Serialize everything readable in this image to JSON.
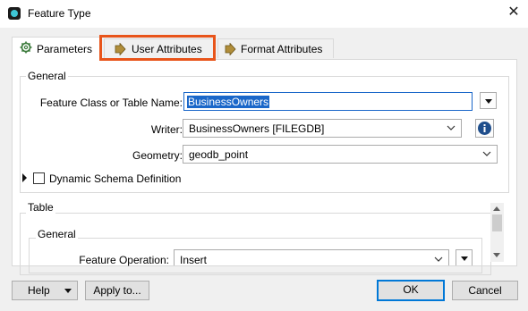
{
  "window": {
    "title": "Feature Type",
    "close_glyph": "✕"
  },
  "tabs": [
    {
      "label": "Parameters",
      "icon": "gear-icon",
      "active": true
    },
    {
      "label": "User Attributes",
      "icon": "arrow-right-icon",
      "active": false,
      "highlighted": true
    },
    {
      "label": "Format Attributes",
      "icon": "arrow-right-icon",
      "active": false
    }
  ],
  "general": {
    "title": "General",
    "feature_class_label": "Feature Class or Table Name:",
    "feature_class_value": "BusinessOwners",
    "writer_label": "Writer:",
    "writer_value": "BusinessOwners [FILEGDB]",
    "geometry_label": "Geometry:",
    "geometry_value": "geodb_point",
    "dynamic_schema_label": "Dynamic Schema Definition"
  },
  "table": {
    "title": "Table",
    "general_title": "General",
    "feature_operation_label": "Feature Operation:",
    "feature_operation_value": "Insert"
  },
  "buttons": {
    "help": "Help",
    "apply_to": "Apply to...",
    "ok": "OK",
    "cancel": "Cancel"
  },
  "colors": {
    "highlight": "#e8541a",
    "accent": "#0078d7",
    "info": "#1f4e8c"
  }
}
